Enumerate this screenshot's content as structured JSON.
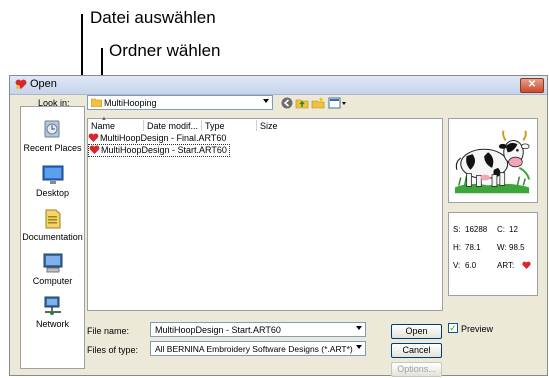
{
  "callouts": {
    "select_file": "Datei auswählen",
    "select_folder": "Ordner wählen"
  },
  "dialog": {
    "title": "Open",
    "close_icon": "close-icon",
    "look_in_label": "Look in:",
    "look_in_value": "MultiHooping",
    "places": [
      {
        "label": "Recent Places",
        "icon": "recent-places-icon"
      },
      {
        "label": "Desktop",
        "icon": "desktop-icon"
      },
      {
        "label": "Documentation",
        "icon": "documents-icon"
      },
      {
        "label": "Computer",
        "icon": "computer-icon"
      },
      {
        "label": "Network",
        "icon": "network-icon"
      }
    ],
    "columns": [
      "Name",
      "Date modif...",
      "Type",
      "Size"
    ],
    "files": [
      {
        "name": "MultiHoopDesign - Final.ART60",
        "selected": false
      },
      {
        "name": "MultiHoopDesign - Start.ART60",
        "selected": true
      }
    ],
    "stats": {
      "s_label": "S:",
      "s_value": "16288",
      "c_label": "C:",
      "c_value": "12",
      "h_label": "H:",
      "h_value": "78.1",
      "w_label": "W:",
      "w_value": "98.5",
      "v_label": "V:",
      "v_value": "6.0",
      "art_label": "ART:"
    },
    "file_name_label": "File name:",
    "file_name_value": "MultiHoopDesign - Start.ART60",
    "files_of_type_label": "Files of type:",
    "files_of_type_value": "All BERNINA Embroidery Software Designs (*.ART*)",
    "open_label": "Open",
    "cancel_label": "Cancel",
    "options_label": "Options...",
    "preview_label": "Preview",
    "preview_checked": true
  },
  "colors": {
    "accent_red": "#d9262c",
    "folder_yellow": "#f2c13d"
  }
}
